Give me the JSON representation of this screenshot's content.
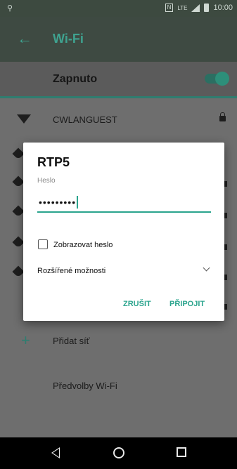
{
  "status_bar": {
    "left_icon": "⚲",
    "nfc": "N",
    "network": "LTE",
    "time": "10:00"
  },
  "toolbar": {
    "back_icon": "←",
    "title": "Wi-Fi"
  },
  "switch_bar": {
    "label": "Zapnuto",
    "enabled": true
  },
  "networks": [
    {
      "name": "CWLANGUEST",
      "secured": true
    }
  ],
  "add_network": {
    "icon": "+",
    "label": "Přidat síť"
  },
  "preferences": {
    "label": "Předvolby Wi-Fi"
  },
  "dialog": {
    "title": "RTP5",
    "field_label": "Heslo",
    "password_value": "•••••••••",
    "show_password_label": "Zobrazovat heslo",
    "show_password_checked": false,
    "advanced_label": "Rozšířené možnosti",
    "cancel_label": "ZRUŠIT",
    "connect_label": "PŘIPOJIT"
  },
  "colors": {
    "accent": "#2aa48d",
    "toolbar": "#3e4a42",
    "scrim": "#6e6e6e"
  }
}
